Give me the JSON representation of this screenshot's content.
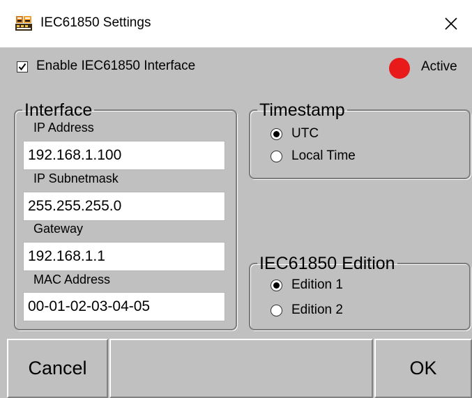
{
  "window": {
    "title": "IEC61850 Settings",
    "icon": "app-icon",
    "close_icon": "close-icon"
  },
  "enable": {
    "label": "Enable IEC61850 Interface",
    "checked": true
  },
  "status": {
    "label": "Active",
    "color": "#e81a1a"
  },
  "interface": {
    "legend": "Interface",
    "fields": [
      {
        "label": "IP Address",
        "value": "192.168.1.100"
      },
      {
        "label": "IP Subnetmask",
        "value": "255.255.255.0"
      },
      {
        "label": "Gateway",
        "value": "192.168.1.1"
      },
      {
        "label": "MAC Address",
        "value": "00-01-02-03-04-05"
      }
    ]
  },
  "timestamp": {
    "legend": "Timestamp",
    "options": [
      {
        "label": "UTC",
        "selected": true
      },
      {
        "label": "Local Time",
        "selected": false
      }
    ]
  },
  "edition": {
    "legend": "IEC61850 Edition",
    "options": [
      {
        "label": "Edition 1",
        "selected": true
      },
      {
        "label": "Edition 2",
        "selected": false
      }
    ]
  },
  "buttons": {
    "cancel": "Cancel",
    "ok": "OK"
  }
}
